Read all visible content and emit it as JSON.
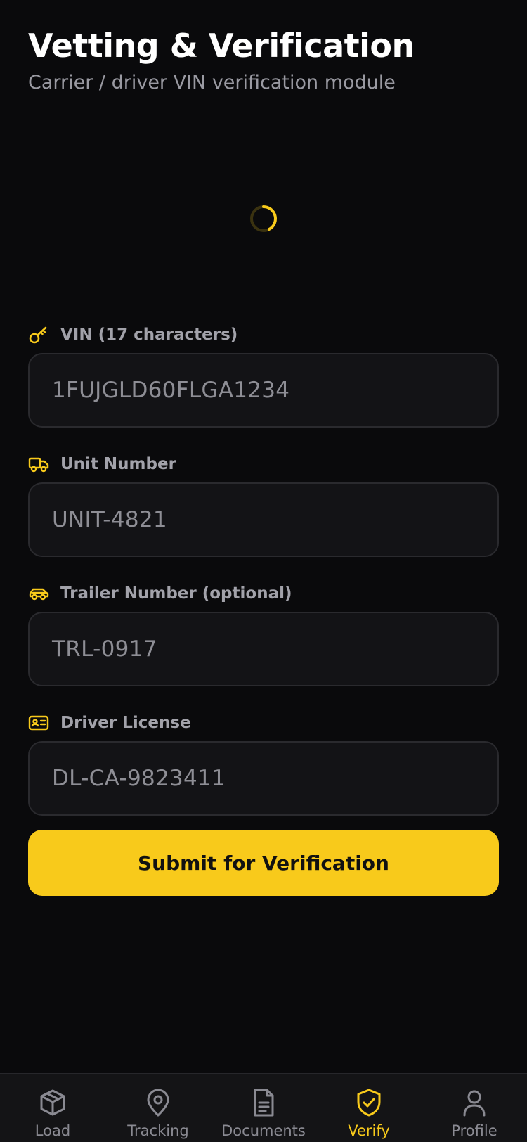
{
  "header": {
    "title": "Vetting & Verification",
    "subtitle": "Carrier / driver VIN verification module"
  },
  "colors": {
    "accent": "#F8CA1B",
    "background": "#0A0A0C",
    "field_bg": "#131316"
  },
  "form": {
    "fields": [
      {
        "label": "VIN (17 characters)",
        "icon": "key-icon",
        "placeholder": "1FUJGLD60FLGA1234"
      },
      {
        "label": "Unit Number",
        "icon": "truck-icon",
        "placeholder": "UNIT-4821"
      },
      {
        "label": "Trailer Number (optional)",
        "icon": "car-icon",
        "placeholder": "TRL-0917"
      },
      {
        "label": "Driver License",
        "icon": "id-card-icon",
        "placeholder": "DL-CA-9823411"
      }
    ],
    "submit_label": "Submit for Verification"
  },
  "tabs": [
    {
      "label": "Load",
      "icon": "box-icon"
    },
    {
      "label": "Tracking",
      "icon": "map-pin-icon"
    },
    {
      "label": "Documents",
      "icon": "document-icon"
    },
    {
      "label": "Verify",
      "icon": "shield-check-icon",
      "active": true
    },
    {
      "label": "Profile",
      "icon": "user-icon"
    }
  ]
}
